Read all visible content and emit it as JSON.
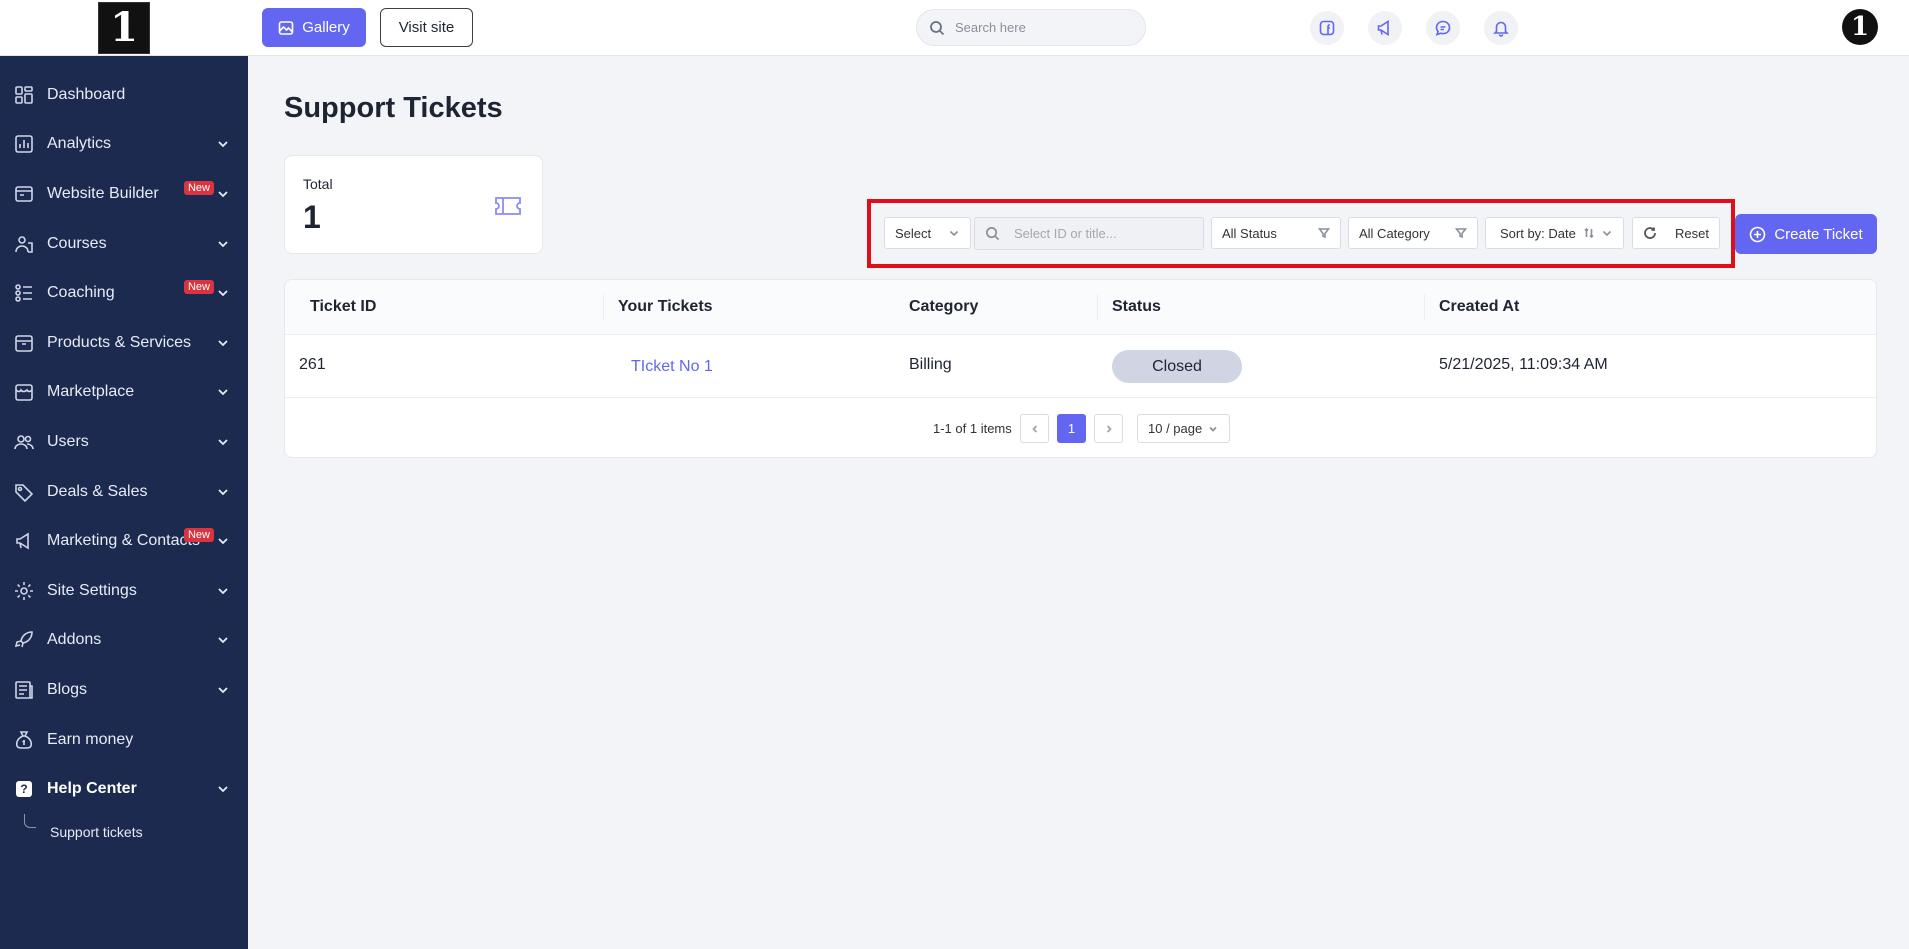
{
  "sidebar": {
    "logo_text": "1",
    "items": [
      {
        "label": "Dashboard",
        "icon": "dashboard-icon",
        "chevron": false,
        "badge": ""
      },
      {
        "label": "Analytics",
        "icon": "chart-icon",
        "chevron": true,
        "badge": ""
      },
      {
        "label": "Website Builder",
        "icon": "builder-icon",
        "chevron": true,
        "badge": "New"
      },
      {
        "label": "Courses",
        "icon": "courses-icon",
        "chevron": true,
        "badge": ""
      },
      {
        "label": "Coaching",
        "icon": "coaching-icon",
        "chevron": true,
        "badge": "New"
      },
      {
        "label": "Products & Services",
        "icon": "box-icon",
        "chevron": true,
        "badge": ""
      },
      {
        "label": "Marketplace",
        "icon": "store-icon",
        "chevron": true,
        "badge": ""
      },
      {
        "label": "Users",
        "icon": "users-icon",
        "chevron": true,
        "badge": ""
      },
      {
        "label": "Deals & Sales",
        "icon": "tag-icon",
        "chevron": true,
        "badge": ""
      },
      {
        "label": "Marketing & Contacts",
        "icon": "megaphone-icon",
        "chevron": true,
        "badge": "New"
      },
      {
        "label": "Site Settings",
        "icon": "gear-icon",
        "chevron": true,
        "badge": ""
      },
      {
        "label": "Addons",
        "icon": "rocket-icon",
        "chevron": true,
        "badge": ""
      },
      {
        "label": "Blogs",
        "icon": "blog-icon",
        "chevron": true,
        "badge": ""
      },
      {
        "label": "Earn money",
        "icon": "money-bag-icon",
        "chevron": false,
        "badge": ""
      },
      {
        "label": "Help Center",
        "icon": "help-icon",
        "chevron": true,
        "badge": ""
      }
    ],
    "help_icon_text": "?",
    "subitem": "Support tickets"
  },
  "topbar": {
    "gallery_label": "Gallery",
    "visit_label": "Visit site",
    "search_placeholder": "Search here",
    "icons": [
      "facebook-icon",
      "megaphone-icon",
      "chat-icon",
      "bell-icon"
    ],
    "avatar_text": "1"
  },
  "page": {
    "title": "Support Tickets",
    "total_label": "Total",
    "total_value": "1"
  },
  "filters": {
    "select_label": "Select",
    "search_placeholder": "Select ID or title...",
    "status_label": "All Status",
    "category_label": "All Category",
    "sort_label": "Sort by: Date",
    "reset_label": "Reset",
    "create_label": "Create Ticket"
  },
  "table": {
    "headers": [
      "Ticket ID",
      "Your Tickets",
      "Category",
      "Status",
      "Created At"
    ],
    "rows": [
      {
        "id": "261",
        "title": "TIcket No 1",
        "category": "Billing",
        "status": "Closed",
        "created": "5/21/2025, 11:09:34 AM"
      }
    ]
  },
  "pagination": {
    "summary": "1-1 of 1 items",
    "current_page": "1",
    "page_size": "10 / page"
  },
  "colors": {
    "sidebar_bg": "#1b2a4e",
    "accent": "#6366f1",
    "highlight_border": "#e10d18",
    "badge_red": "#d9343f"
  }
}
